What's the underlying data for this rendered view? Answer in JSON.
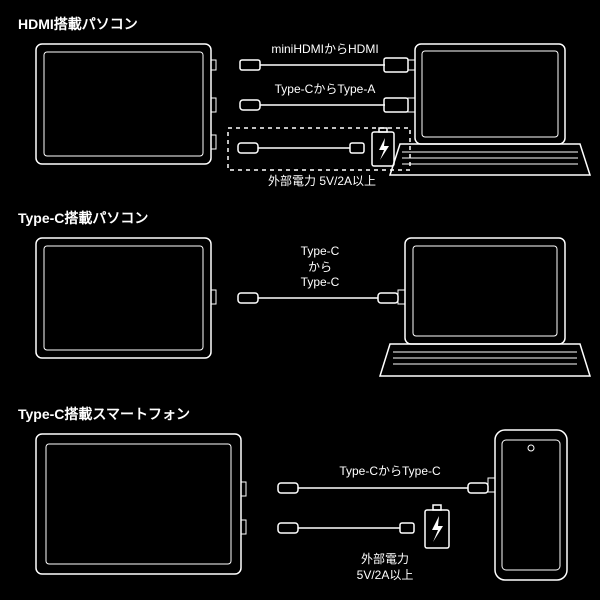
{
  "section1": {
    "title": "HDMI搭載パソコン",
    "cable1": "miniHDMIからHDMI",
    "cable2": "Type-CからType-A",
    "power": "外部電力 5V/2A以上"
  },
  "section2": {
    "title": "Type-C搭載パソコン",
    "cable": "Type-C\nから\nType-C"
  },
  "section3": {
    "title": "Type-C搭載スマートフォン",
    "cable": "Type-CからType-C",
    "power": "外部電力\n5V/2A以上"
  }
}
